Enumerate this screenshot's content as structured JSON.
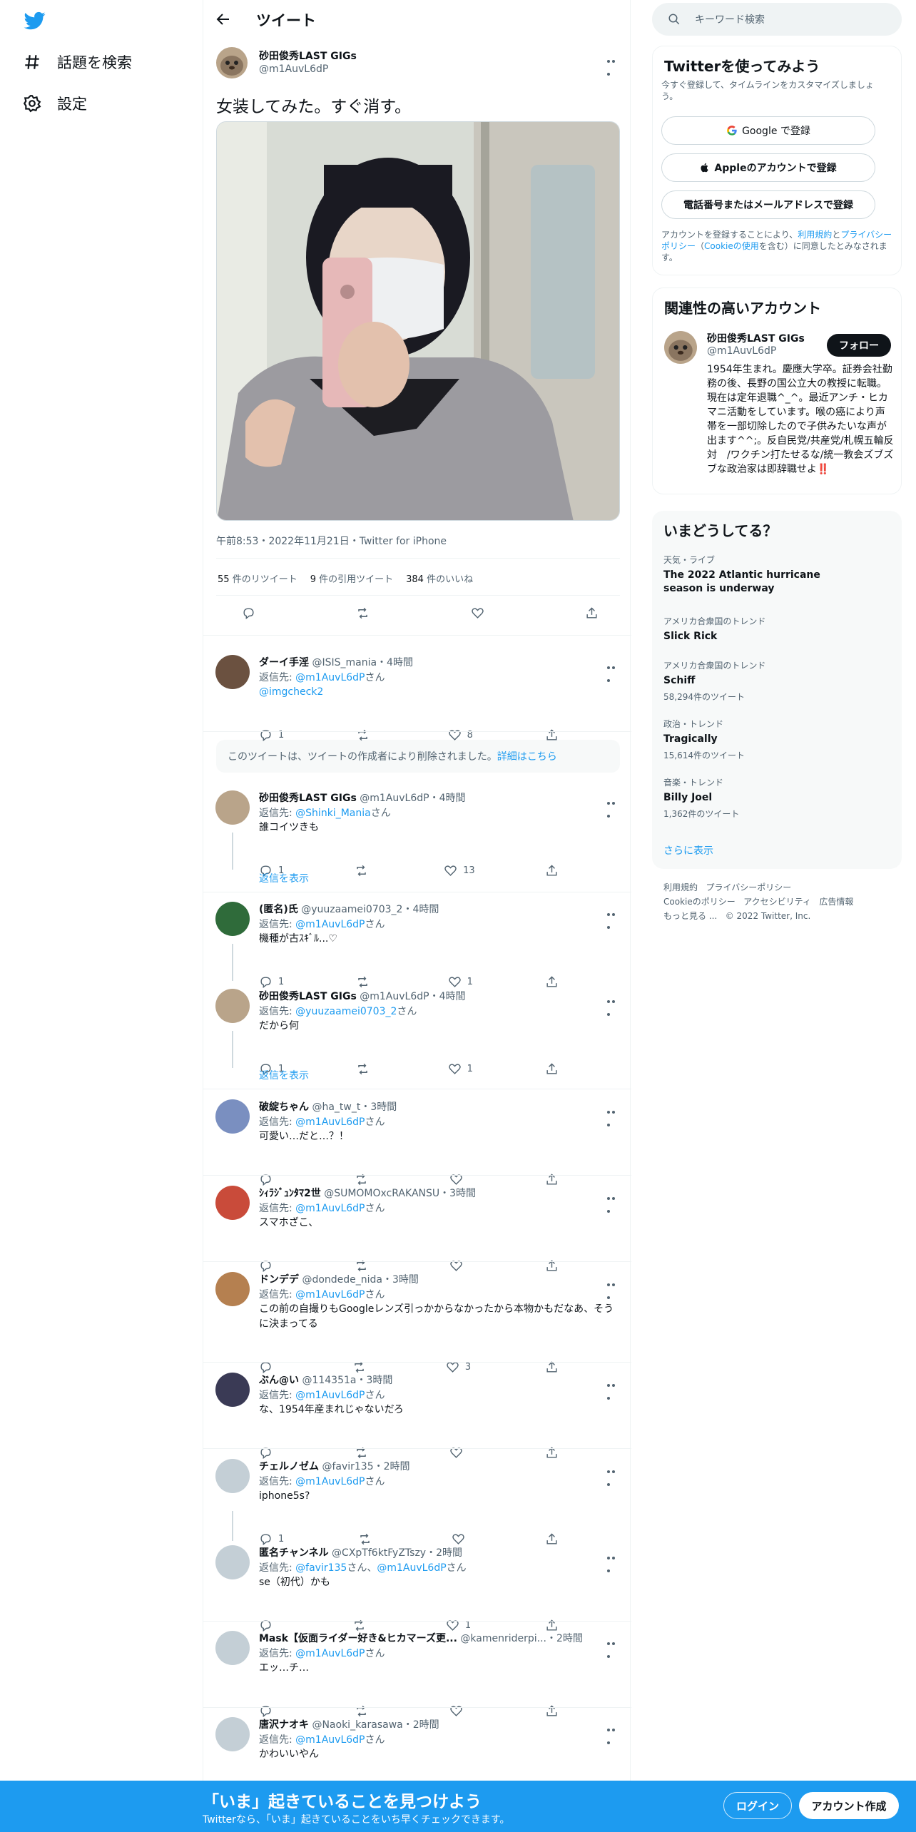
{
  "nav": {
    "explore_label": "話題を検索",
    "settings_label": "設定"
  },
  "header": {
    "title": "ツイート"
  },
  "main_tweet": {
    "name": "砂田俊秀LAST GIGs",
    "handle": "@m1AuvL6dP",
    "text": "女装してみた。すぐ消す。",
    "meta": "午前8:53・2022年11月21日・Twitter for iPhone",
    "retweets_count": "55",
    "retweets_label": "件のリツイート",
    "quotes_count": "9",
    "quotes_label": "件の引用ツイート",
    "likes_count": "384",
    "likes_label": "件のいいね"
  },
  "deleted_notice": {
    "text": "このツイートは、ツイートの作成者により削除されました。",
    "link": "詳細はこちら"
  },
  "show_replies_label": "返信を表示",
  "replies": [
    {
      "name": "ダーイ手淫",
      "handle": "@ISIS_mania",
      "time": "・4時間",
      "reply_prefix": "返信先: ",
      "reply_to": "@m1AuvL6dP",
      "reply_suffix": "さん",
      "body": "@imgcheck2",
      "replies": "1",
      "retweets": "",
      "likes": "8"
    },
    {
      "name": "砂田俊秀LAST GIGs",
      "handle": "@m1AuvL6dP",
      "time": "・4時間",
      "reply_prefix": "返信先: ",
      "reply_to": "@Shinki_Mania",
      "reply_suffix": "さん",
      "body": "誰コイツきも",
      "replies": "1",
      "retweets": "",
      "likes": "13"
    },
    {
      "name": "(匿名)氏",
      "handle": "@yuuzaamei0703_2",
      "time": "・4時間",
      "reply_prefix": "返信先: ",
      "reply_to": "@m1AuvL6dP",
      "reply_suffix": "さん",
      "body": "機種が古ｽｷﾞﾙ...♡",
      "replies": "1",
      "retweets": "",
      "likes": "1"
    },
    {
      "name": "砂田俊秀LAST GIGs",
      "handle": "@m1AuvL6dP",
      "time": "・4時間",
      "reply_prefix": "返信先: ",
      "reply_to": "@yuuzaamei0703_2",
      "reply_suffix": "さん",
      "body": "だから何",
      "replies": "1",
      "retweets": "",
      "likes": "1"
    },
    {
      "name": "破綻ちゃん",
      "handle": "@ha_tw_t",
      "time": "・3時間",
      "reply_prefix": "返信先: ",
      "reply_to": "@m1AuvL6dP",
      "reply_suffix": "さん",
      "body": "可愛い…だと…？！",
      "replies": "",
      "retweets": "",
      "likes": ""
    },
    {
      "name": "ｼｨﾗｼﾞｭﾝﾀﾏ2世",
      "handle": "@SUMOMOxcRAKANSU",
      "time": "・3時間",
      "reply_prefix": "返信先: ",
      "reply_to": "@m1AuvL6dP",
      "reply_suffix": "さん",
      "body": "スマホざこ、",
      "replies": "",
      "retweets": "",
      "likes": ""
    },
    {
      "name": "ドンデデ",
      "handle": "@dondede_nida",
      "time": "・3時間",
      "reply_prefix": "返信先: ",
      "reply_to": "@m1AuvL6dP",
      "reply_suffix": "さん",
      "body": "この前の自撮りもGoogleレンズ引っかからなかったから本物かもだなあ、そうに決まってる",
      "replies": "",
      "retweets": "",
      "likes": "3"
    },
    {
      "name": "ぶん@い",
      "handle": "@114351a",
      "time": "・3時間",
      "reply_prefix": "返信先: ",
      "reply_to": "@m1AuvL6dP",
      "reply_suffix": "さん",
      "body": "な、1954年産まれじゃないだろ",
      "replies": "",
      "retweets": "",
      "likes": ""
    },
    {
      "name": "チェルノゼム",
      "handle": "@favir135",
      "time": "・2時間",
      "reply_prefix": "返信先: ",
      "reply_to": "@m1AuvL6dP",
      "reply_suffix": "さん",
      "body": "iphone5s?",
      "replies": "1",
      "retweets": "",
      "likes": ""
    },
    {
      "name": "匿名チャンネル",
      "handle": "@CXpTf6ktFyZTszy",
      "time": "・2時間",
      "reply_prefix": "返信先: ",
      "reply_to": "@favir135",
      "reply_suffix": "さん、",
      "reply_to_2": "@m1AuvL6dP",
      "reply_suffix_2": "さん",
      "body": "se（初代）かも",
      "replies": "",
      "retweets": "",
      "likes": "1"
    },
    {
      "name": "Mask【仮面ライダー好き&ヒカマーズ更...",
      "handle": "@kamenriderpi...",
      "time": "・2時間",
      "reply_prefix": "返信先: ",
      "reply_to": "@m1AuvL6dP",
      "reply_suffix": "さん",
      "body": "エッ…チ…",
      "replies": "",
      "retweets": "",
      "likes": ""
    },
    {
      "name": "唐沢ナオキ",
      "handle": "@Naoki_karasawa",
      "time": "・2時間",
      "reply_prefix": "返信先: ",
      "reply_to": "@m1AuvL6dP",
      "reply_suffix": "さん",
      "body": "かわいいやん",
      "replies": "",
      "retweets": "",
      "likes": ""
    }
  ],
  "sidebar": {
    "search_placeholder": "キーワード検索",
    "signup_card": {
      "title": "Twitterを使ってみよう",
      "subtitle": "今すぐ登録して、タイムラインをカスタマイズしましょう。",
      "google_btn": "Google で登録",
      "apple_btn": "Appleのアカウントで登録",
      "phone_btn": "電話番号またはメールアドレスで登録",
      "terms_1": "アカウントを登録することにより、",
      "terms_link1": "利用規約",
      "terms_2": "と",
      "terms_link2": "プライバシーポリシー",
      "terms_3": "（",
      "terms_link3": "Cookieの使用",
      "terms_4": "を含む）に同意したとみなされます。"
    },
    "related_card": {
      "title": "関連性の高いアカウント",
      "name": "砂田俊秀LAST GIGs",
      "handle": "@m1AuvL6dP",
      "follow_label": "フォロー",
      "bio": "1954年生まれ。慶應大学卒。証券会社勤務の後、長野の国公立大の教授に転職。現在は定年退職^_^。最近アンチ・ヒカマニ活動をしています。喉の癌により声帯を一部切除したので子供みたいな声が出ます^^;。反自民党/共産党/札幌五輪反対　/ワクチン打たせるな/統一教会ズブズブな政治家は即辞職せよ‼️"
    },
    "trends_card": {
      "title": "いまどうしてる？",
      "items": [
        {
          "category": "天気・ライブ",
          "name": "The 2022 Atlantic hurricane season is underway",
          "count": ""
        },
        {
          "category": "アメリカ合衆国のトレンド",
          "name": "Slick Rick",
          "count": ""
        },
        {
          "category": "アメリカ合衆国のトレンド",
          "name": "Schiff",
          "count": "58,294件のツイート"
        },
        {
          "category": "政治・トレンド",
          "name": "Tragically",
          "count": "15,614件のツイート"
        },
        {
          "category": "音楽・トレンド",
          "name": "Billy Joel",
          "count": "1,362件のツイート"
        }
      ],
      "show_more": "さらに表示"
    },
    "footer": {
      "terms": "利用規約",
      "privacy": "プライバシーポリシー",
      "cookie": "Cookieのポリシー",
      "accessibility": "アクセシビリティ",
      "ads": "広告情報",
      "more": "もっと見る ...",
      "copyright": "© 2022 Twitter, Inc."
    }
  },
  "bottom_bar": {
    "title": "「いま」起きていることを見つけよう",
    "subtitle": "Twitterなら、「いま」起きていることをいち早くチェックできます。",
    "login_label": "ログイン",
    "signup_label": "アカウント作成"
  },
  "colors": {
    "brand": "#1d9bf0",
    "text": "#0f1419",
    "secondary": "#536471"
  }
}
